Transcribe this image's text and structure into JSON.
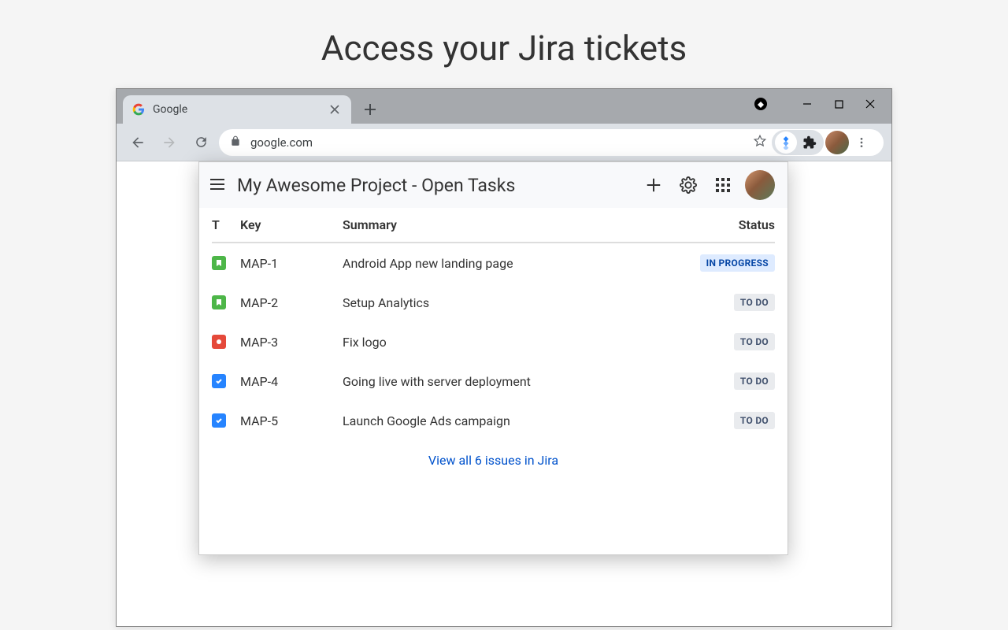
{
  "page_heading": "Access your Jira tickets",
  "browser": {
    "tab_title": "Google",
    "url": "google.com"
  },
  "popup": {
    "title": "My Awesome Project - Open Tasks",
    "columns": {
      "type": "T",
      "key": "Key",
      "summary": "Summary",
      "status": "Status"
    },
    "issues": [
      {
        "type": "story",
        "key": "MAP-1",
        "summary": "Android App new landing page",
        "status": "IN PROGRESS",
        "status_kind": "inprogress"
      },
      {
        "type": "story",
        "key": "MAP-2",
        "summary": "Setup Analytics",
        "status": "TO DO",
        "status_kind": "todo"
      },
      {
        "type": "bug",
        "key": "MAP-3",
        "summary": "Fix logo",
        "status": "TO DO",
        "status_kind": "todo"
      },
      {
        "type": "task",
        "key": "MAP-4",
        "summary": "Going live with server deployment",
        "status": "TO DO",
        "status_kind": "todo"
      },
      {
        "type": "task",
        "key": "MAP-5",
        "summary": "Launch Google Ads campaign",
        "status": "TO DO",
        "status_kind": "todo"
      }
    ],
    "view_all": "View all 6 issues in Jira"
  }
}
